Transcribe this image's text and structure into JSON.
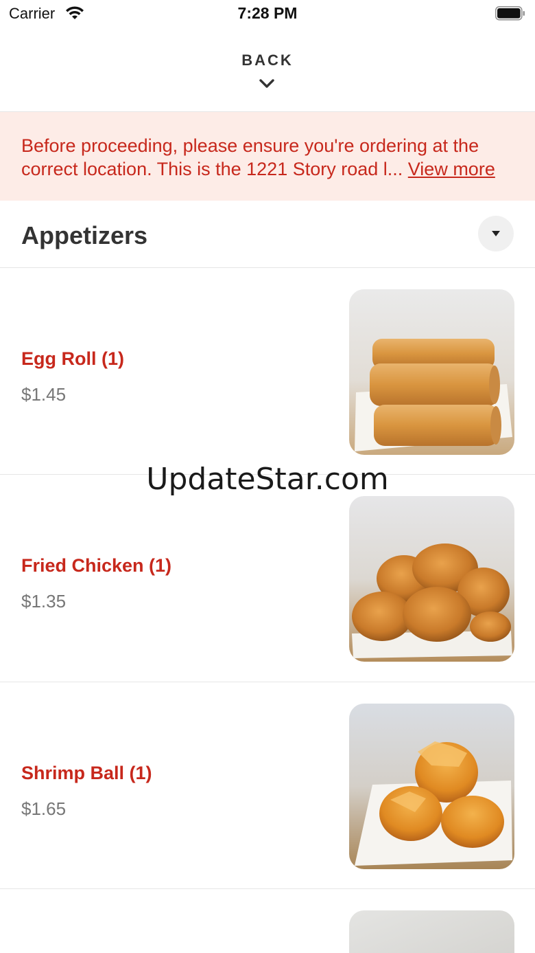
{
  "status_bar": {
    "carrier": "Carrier",
    "time": "7:28 PM",
    "wifi_icon": "wifi-icon",
    "battery_icon": "battery-full-icon"
  },
  "header": {
    "back_label": "BACK",
    "chevron_icon": "chevron-down-icon"
  },
  "notice": {
    "text": "Before proceeding, please ensure you're ordering at the correct location. This is the 1221 Story road l... ",
    "link_label": "View more",
    "color": "#c7281c",
    "background": "#fdece7"
  },
  "category": {
    "title": "Appetizers",
    "toggle_icon": "caret-down-icon"
  },
  "items": [
    {
      "name": "Egg Roll (1)",
      "price": "$1.45",
      "photo": "egg-roll-photo"
    },
    {
      "name": "Fried Chicken (1)",
      "price": "$1.35",
      "photo": "fried-chicken-photo"
    },
    {
      "name": "Shrimp Ball (1)",
      "price": "$1.65",
      "photo": "shrimp-ball-photo"
    }
  ],
  "watermark": "UpdateStar.com",
  "colors": {
    "accent": "#c7281c",
    "price": "#777777",
    "heading": "#333333"
  }
}
